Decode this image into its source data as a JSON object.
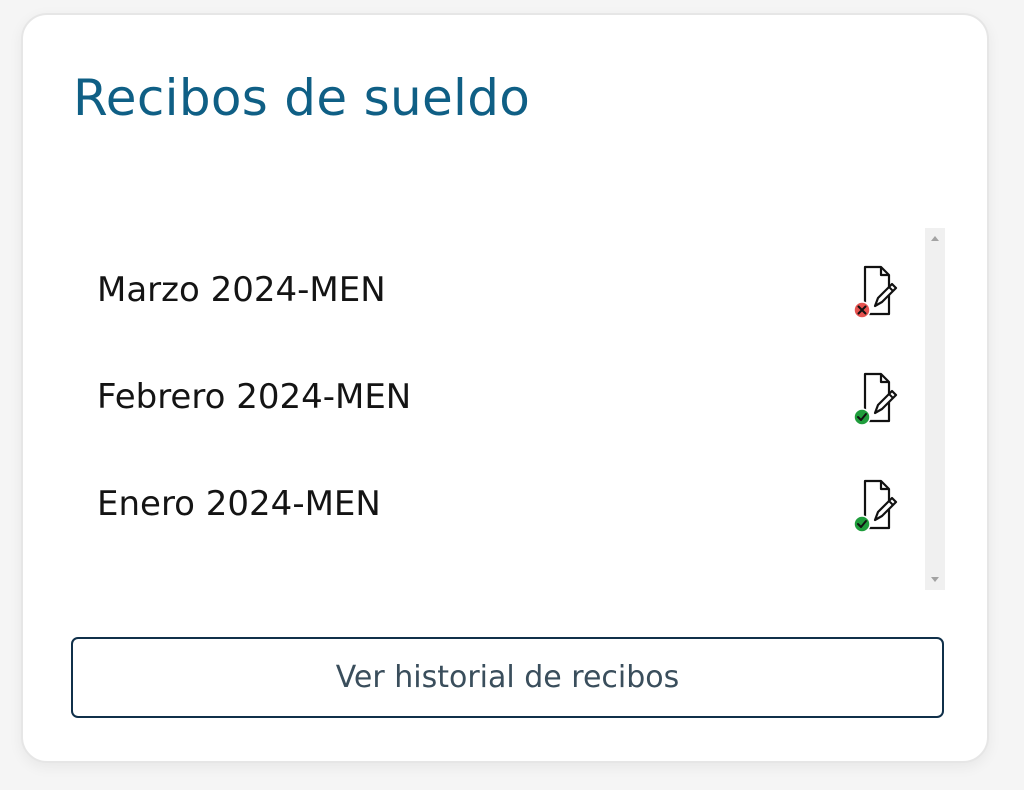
{
  "card": {
    "title": "Recibos de sueldo"
  },
  "receipts": [
    {
      "label": "Marzo 2024-MEN",
      "icon": "document-sign-icon",
      "status": "rejected",
      "status_color": "#e5524f"
    },
    {
      "label": "Febrero 2024-MEN",
      "icon": "document-sign-icon",
      "status": "signed",
      "status_color": "#1f9d3c"
    },
    {
      "label": "Enero 2024-MEN",
      "icon": "document-sign-icon",
      "status": "signed",
      "status_color": "#1f9d3c"
    }
  ],
  "history_button": {
    "label": "Ver historial de recibos"
  },
  "colors": {
    "title": "#0f5f85",
    "button_border": "#10304a",
    "status_rejected": "#e5524f",
    "status_signed": "#1f9d3c"
  }
}
